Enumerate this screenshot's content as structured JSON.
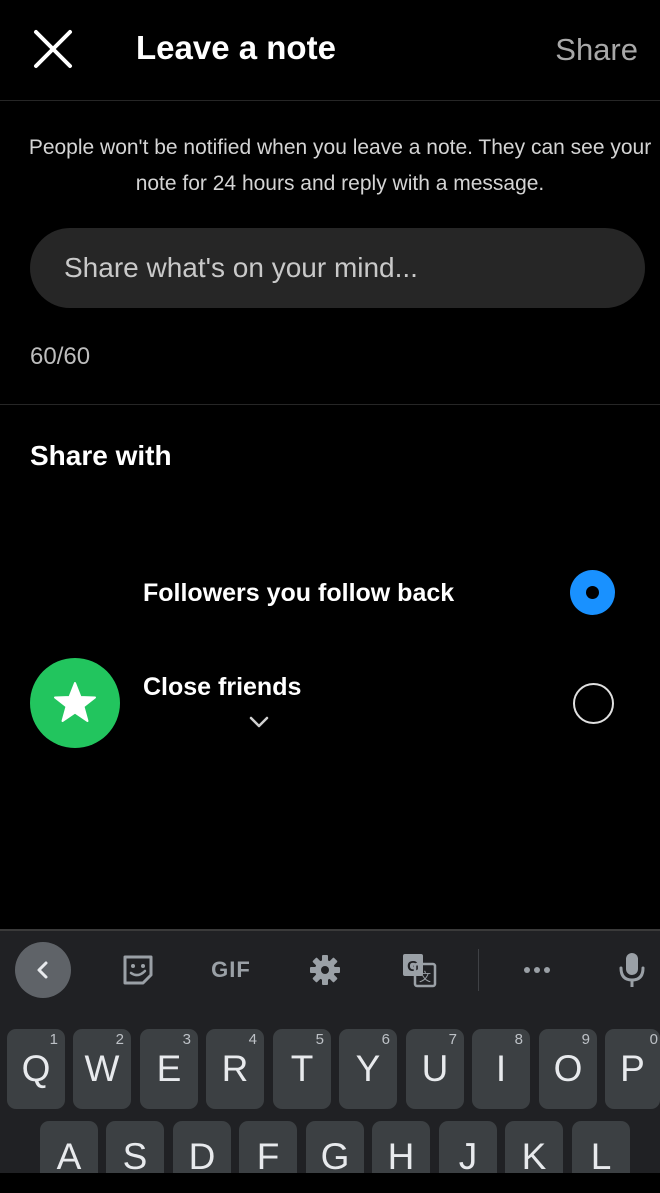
{
  "header": {
    "title": "Leave a note",
    "share_label": "Share"
  },
  "notice": "People won't be notified when you leave a note. They can see your note for 24 hours and reply with a message.",
  "note": {
    "placeholder": "Share what's on your mind...",
    "value": "",
    "char_count": "60/60"
  },
  "share_with": {
    "heading": "Share with",
    "options": [
      {
        "label": "Followers you follow back",
        "selected": true
      },
      {
        "label": "Close friends",
        "selected": false
      }
    ]
  },
  "keyboard": {
    "toolbar": {
      "items": [
        "back-icon",
        "sticker-icon",
        "GIF",
        "gear-icon",
        "translate-icon",
        "more-icon",
        "mic-icon"
      ],
      "gif_label": "GIF"
    },
    "row1": [
      {
        "key": "Q",
        "hint": "1"
      },
      {
        "key": "W",
        "hint": "2"
      },
      {
        "key": "E",
        "hint": "3"
      },
      {
        "key": "R",
        "hint": "4"
      },
      {
        "key": "T",
        "hint": "5"
      },
      {
        "key": "Y",
        "hint": "6"
      },
      {
        "key": "U",
        "hint": "7"
      },
      {
        "key": "I",
        "hint": "8"
      },
      {
        "key": "O",
        "hint": "9"
      },
      {
        "key": "P",
        "hint": "0"
      }
    ],
    "row2": [
      {
        "key": "A"
      },
      {
        "key": "S"
      },
      {
        "key": "D"
      },
      {
        "key": "F"
      },
      {
        "key": "G"
      },
      {
        "key": "H"
      },
      {
        "key": "J"
      },
      {
        "key": "K"
      },
      {
        "key": "L"
      }
    ]
  },
  "colors": {
    "background": "#000000",
    "accent": "#1991ff",
    "close_friends": "#22c55e",
    "input_bg": "#262626"
  }
}
